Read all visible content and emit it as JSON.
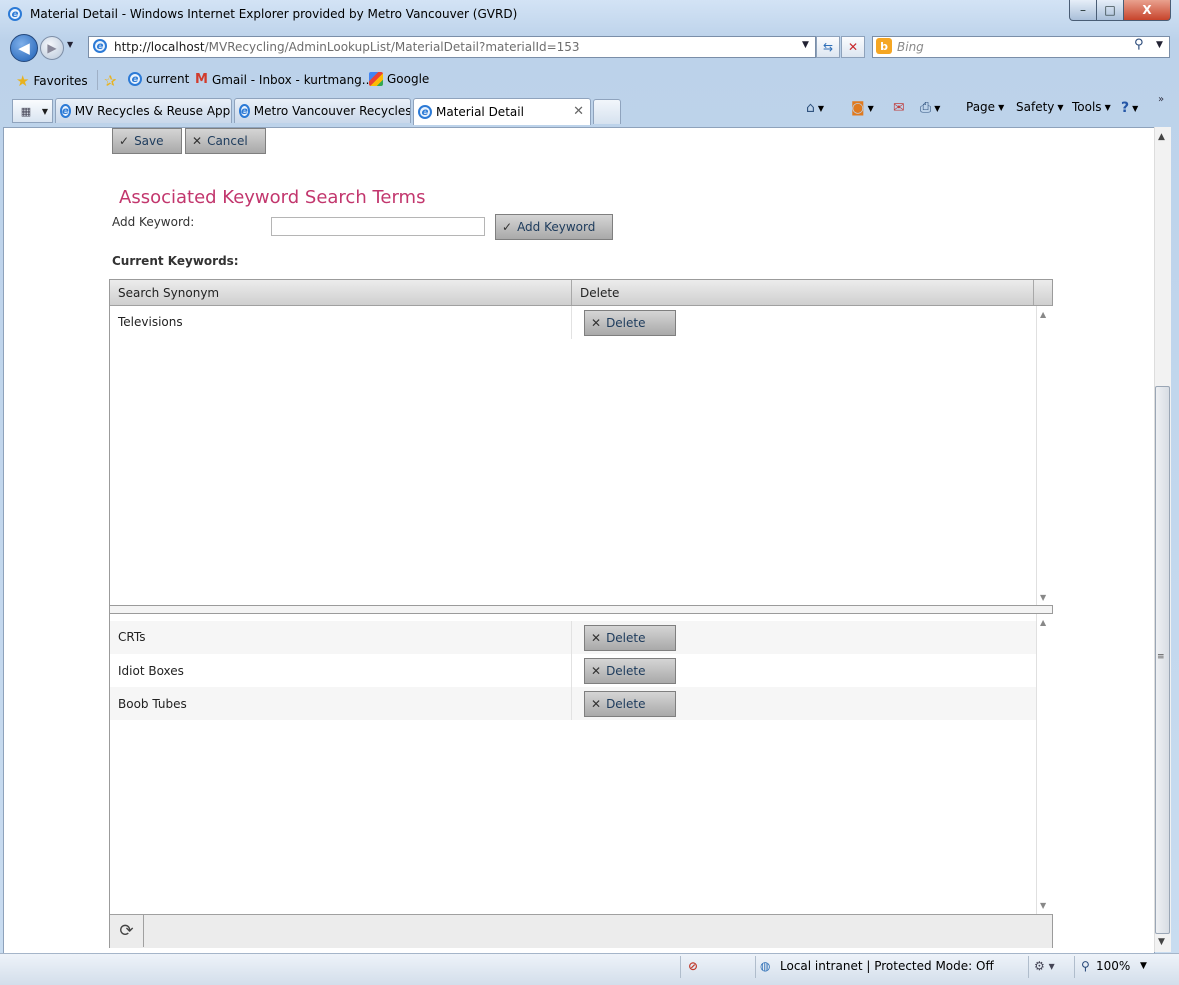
{
  "window": {
    "title": "Material Detail - Windows Internet Explorer provided by Metro Vancouver (GVRD)",
    "minimize": "–",
    "maximize": "□",
    "close": "X"
  },
  "address": {
    "url_host": "http://localhost",
    "url_path": "/MVRecycling/AdminLookupList/MaterialDetail?materialId=153"
  },
  "search": {
    "placeholder": "Bing",
    "logo": "b"
  },
  "favorites": {
    "label": "Favorites",
    "items": [
      {
        "label": "current"
      },
      {
        "label": "Gmail - Inbox - kurtmang..."
      },
      {
        "label": "Google"
      }
    ]
  },
  "tabs": [
    {
      "label": "MV Recycles & Reuse Appl..."
    },
    {
      "label": "Metro Vancouver Recycles..."
    },
    {
      "label": "Material Detail",
      "active": true
    }
  ],
  "commandbar": {
    "page": "Page",
    "safety": "Safety",
    "tools": "Tools"
  },
  "form": {
    "save_label": "Save",
    "cancel_label": "Cancel",
    "section_title": "Associated Keyword Search Terms",
    "add_keyword_label": "Add Keyword:",
    "add_keyword_value": "",
    "add_keyword_button": "Add Keyword",
    "current_keywords_label": "Current Keywords:"
  },
  "grid": {
    "columns": [
      "Search Synonym",
      "Delete"
    ],
    "delete_label": "Delete",
    "pane1_rows": [
      {
        "synonym": "Televisions"
      }
    ],
    "pane2_rows": [
      {
        "synonym": "CRTs"
      },
      {
        "synonym": "Idiot Boxes"
      },
      {
        "synonym": "Boob Tubes"
      }
    ]
  },
  "statusbar": {
    "zone": "Local intranet | Protected Mode: Off",
    "zoom": "100%"
  },
  "colors": {
    "heading": "#c2366d",
    "button_text": "#1d3b5c"
  }
}
